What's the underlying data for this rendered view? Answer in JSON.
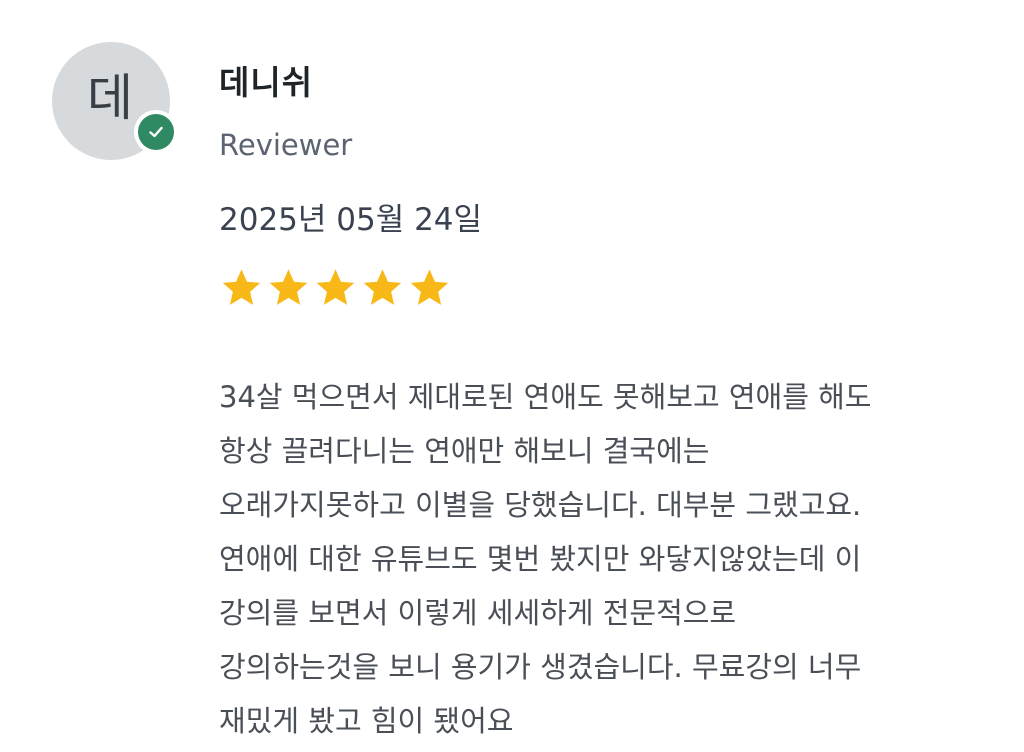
{
  "review": {
    "avatar_initial": "데",
    "reviewer_name": "데니쉬",
    "reviewer_role": "Reviewer",
    "date": "2025년 05월 24일",
    "rating": 5,
    "rating_max": 5,
    "body": "34살 먹으면서 제대로된 연애도 못해보고 연애를 해도\n항상 끌려다니는 연애만 해보니 결국에는\n오래가지못하고 이별을 당했습니다. 대부분 그랬고요.\n연애에 대한 유튜브도 몇번 봤지만 와닿지않았는데 이\n강의를 보면서 이렇게 세세하게 전문적으로\n강의하는것을 보니 용기가 생겼습니다. 무료강의 너무\n재밌게 봤고 힘이 됐어요"
  },
  "colors": {
    "avatar_bg": "#d6dadd",
    "verified_badge": "#2f8a63",
    "star": "#f8b818"
  },
  "icons": {
    "badge": "check-icon",
    "rating": "star-icon"
  }
}
